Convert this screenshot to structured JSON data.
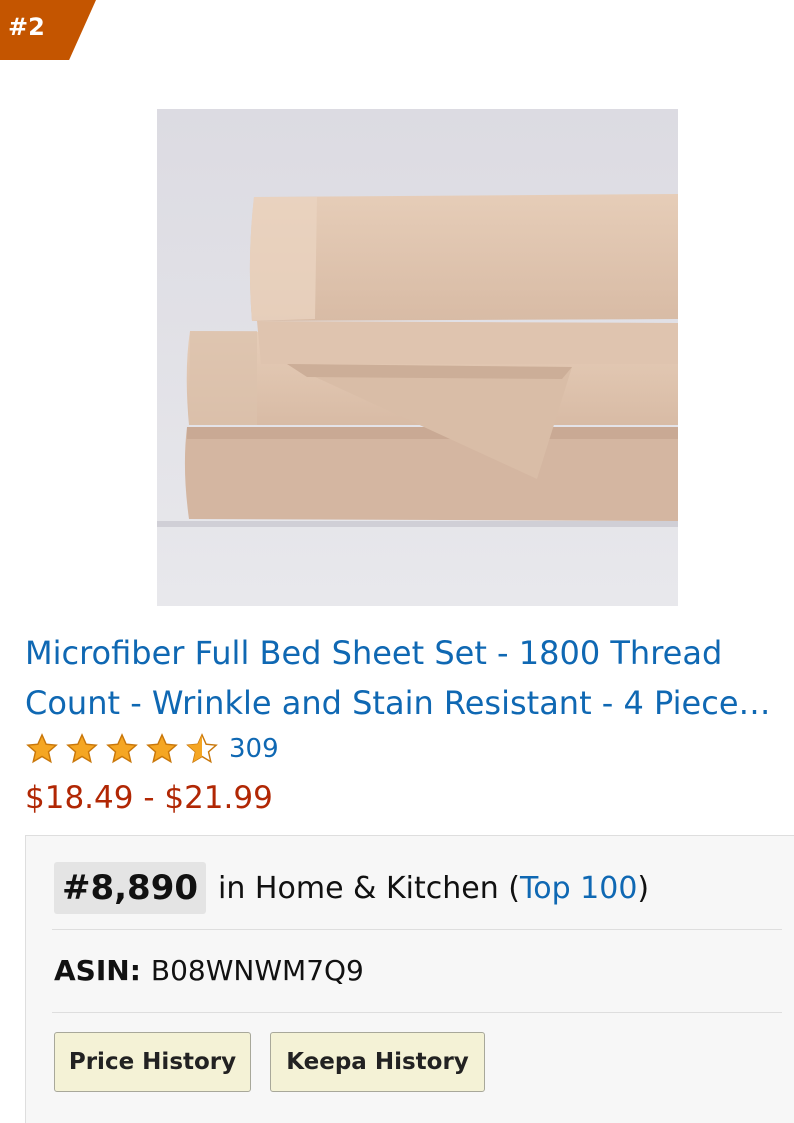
{
  "badge": {
    "rank": "#2",
    "color": "#c45500"
  },
  "product": {
    "image_alt": "Microfiber Full Bed Sheet Set",
    "title": "Microfiber Full Bed Sheet Set - 1800 Thread Count - Wrinkle and Stain Resistant - 4 Piece…",
    "rating": 4.5,
    "rating_max": 5,
    "review_count": "309",
    "price": "$18.49 - $21.99"
  },
  "info": {
    "rank_value": "#8,890",
    "rank_in": "in Home & Kitchen (",
    "rank_link": "Top 100",
    "rank_close": ")",
    "asin_label": "ASIN:",
    "asin_value": "B08WNWM7Q9",
    "price_history_label": "Price History",
    "keepa_history_label": "Keepa History"
  },
  "colors": {
    "link": "#0f68b3",
    "price": "#b12704",
    "star": "#f5a623"
  }
}
